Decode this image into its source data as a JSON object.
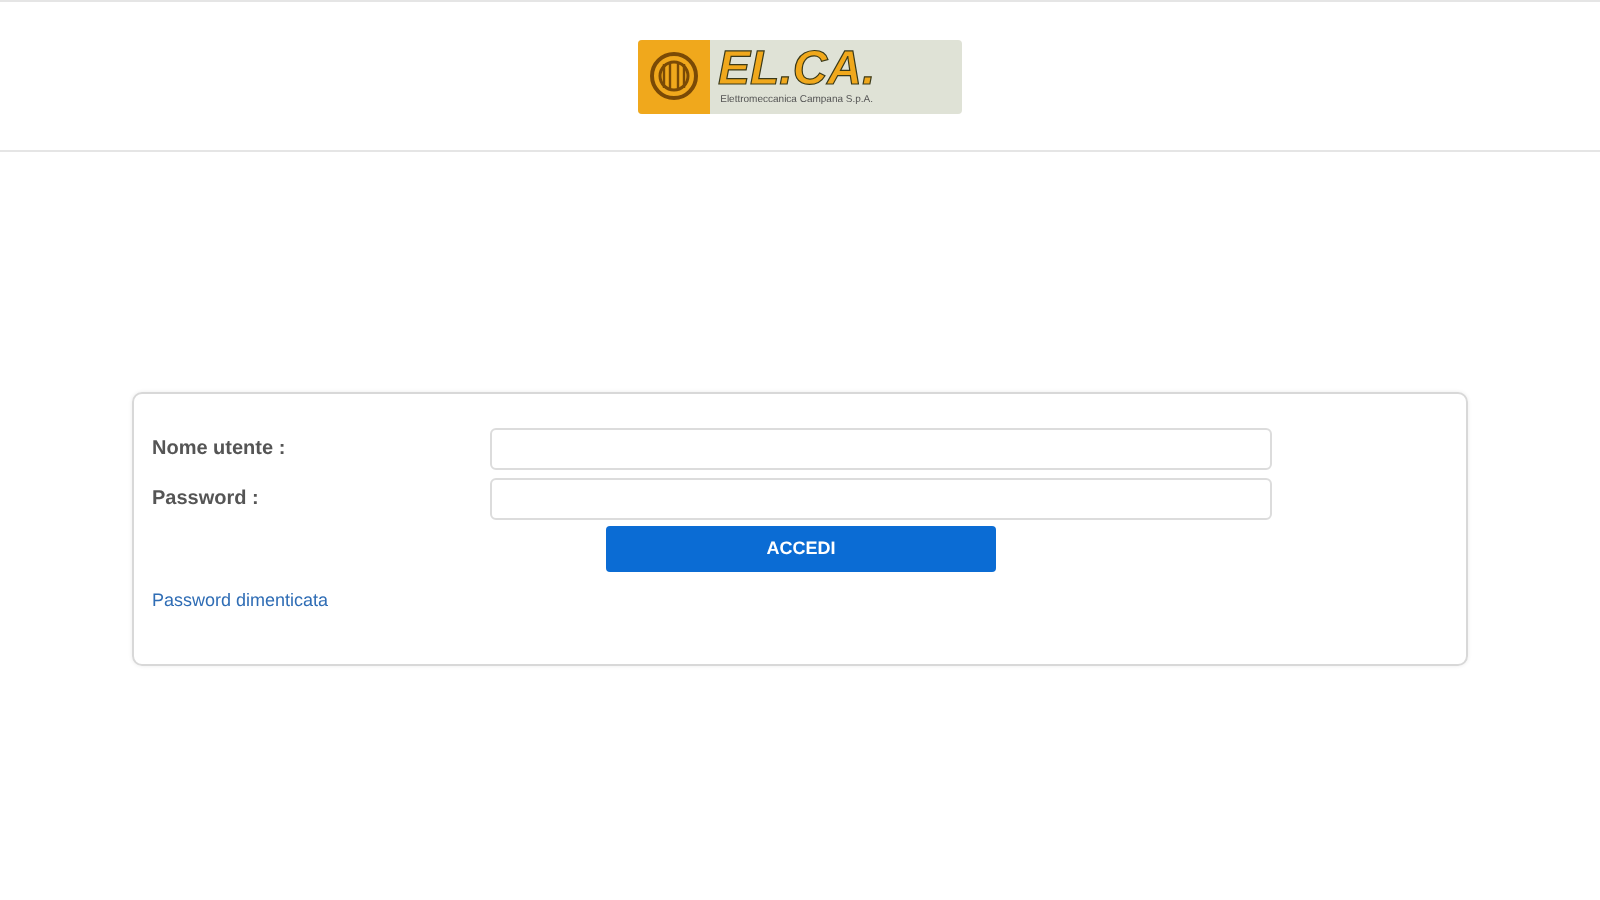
{
  "logo": {
    "title": "EL.CA.",
    "subtitle": "Elettromeccanica Campana S.p.A."
  },
  "login_form": {
    "fields": [
      {
        "label": "Nome utente :"
      },
      {
        "label": "Password :"
      }
    ],
    "submit": "ACCEDI",
    "forgot_link": "Password dimenticata"
  }
}
